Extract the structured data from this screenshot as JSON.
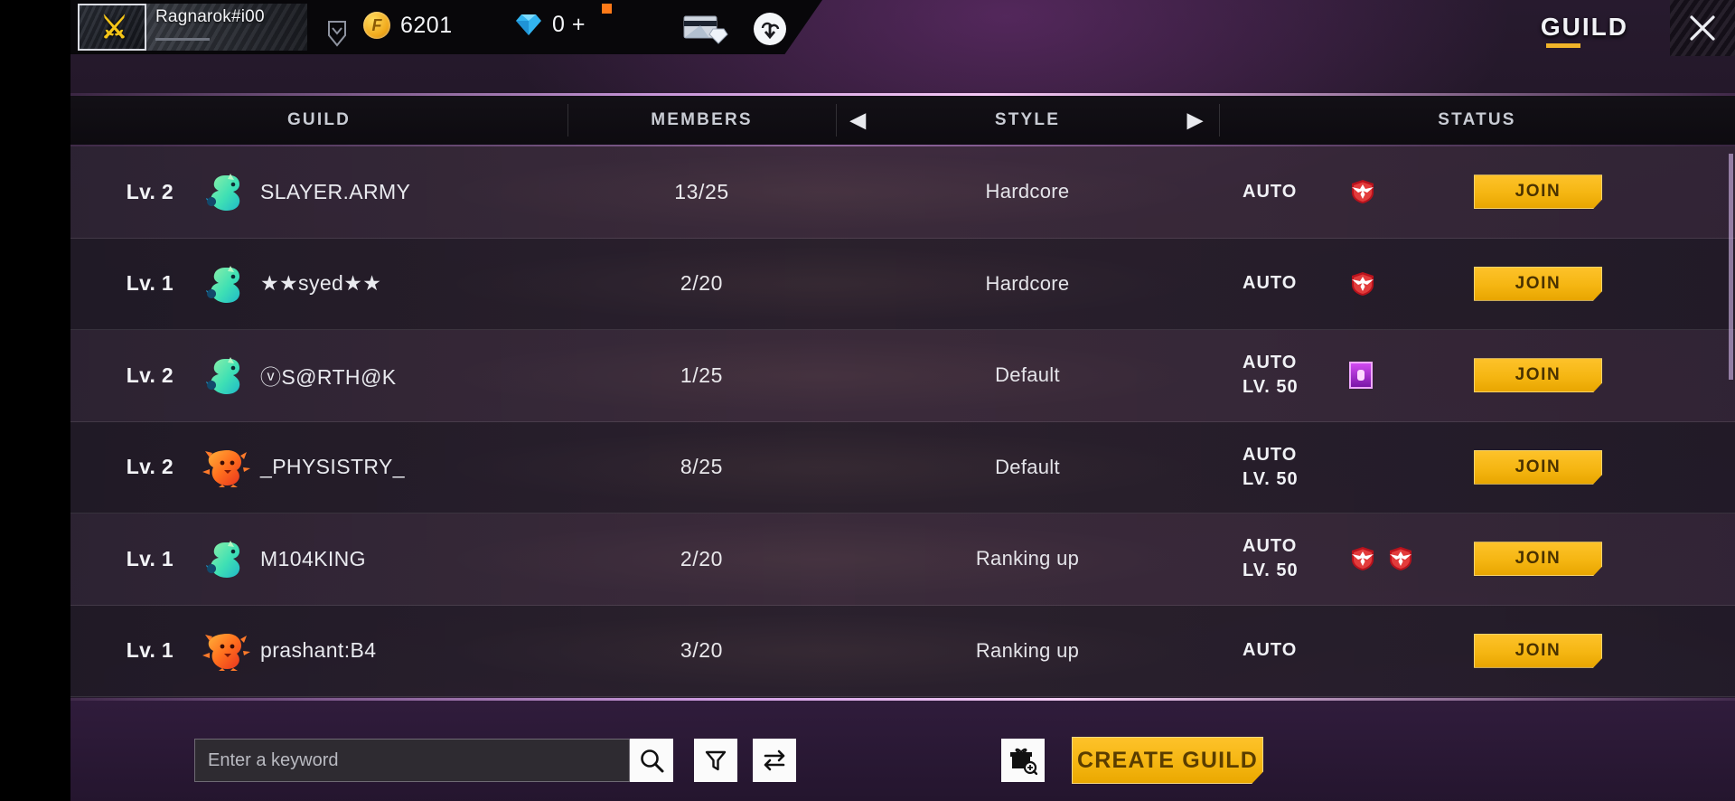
{
  "topbar": {
    "player_name": "Ragnarok#i00",
    "avatar_icon": "sword-emblem-icon",
    "rank_icon": "rank-chevron-icon",
    "gold": {
      "icon": "gold-coin-icon",
      "value": "6201"
    },
    "diamond": {
      "icon": "diamond-icon",
      "value": "0 +",
      "badge": "notification-dot"
    },
    "store_icon": "card-diamond-store-icon",
    "download_icon": "cloud-download-icon"
  },
  "header": {
    "title": "GUILD",
    "close_label": "close-icon"
  },
  "table": {
    "columns": [
      {
        "key": "guild",
        "label": "GUILD"
      },
      {
        "key": "members",
        "label": "MEMBERS"
      },
      {
        "key": "style",
        "label": "STYLE",
        "arrow_left": "◀",
        "arrow_right": "▶"
      },
      {
        "key": "status",
        "label": "STATUS"
      }
    ],
    "join_label": "JOIN",
    "rows": [
      {
        "level": "Lv. 2",
        "emblem": "dragon-emblem-green",
        "name": "SLAYER.ARMY",
        "members": "13/25",
        "style": "Hardcore",
        "status_line1": "AUTO",
        "status_line2": "",
        "badges": [
          "heroic-rank-badge"
        ]
      },
      {
        "level": "Lv. 1",
        "emblem": "dragon-emblem-green",
        "name": "★★syed★★",
        "members": "2/20",
        "style": "Hardcore",
        "status_line1": "AUTO",
        "status_line2": "",
        "badges": [
          "heroic-rank-badge"
        ]
      },
      {
        "level": "Lv. 2",
        "emblem": "dragon-emblem-green",
        "name": "ⓥS@RTH@K",
        "members": "1/25",
        "style": "Default",
        "status_line1": "AUTO",
        "status_line2": "LV. 50",
        "badges": [
          "purple-item-badge"
        ]
      },
      {
        "level": "Lv. 2",
        "emblem": "lion-emblem-orange",
        "name": "_PHYSISTRY_",
        "members": "8/25",
        "style": "Default",
        "status_line1": "AUTO",
        "status_line2": "LV. 50",
        "badges": []
      },
      {
        "level": "Lv. 1",
        "emblem": "dragon-emblem-green",
        "name": "M104KING",
        "members": "2/20",
        "style": "Ranking up",
        "status_line1": "AUTO",
        "status_line2": "LV. 50",
        "badges": [
          "heroic-rank-badge",
          "heroic-rank-badge"
        ]
      },
      {
        "level": "Lv. 1",
        "emblem": "lion-emblem-orange",
        "name": "prashant:B4",
        "members": "3/20",
        "style": "Ranking up",
        "status_line1": "AUTO",
        "status_line2": "",
        "badges": []
      }
    ]
  },
  "bottombar": {
    "search_placeholder": "Enter a keyword",
    "search_value": "",
    "search_icon": "search-icon",
    "filter_icon": "filter-icon",
    "sort_icon": "sort-swap-icon",
    "gift_icon": "gift-search-icon",
    "create_label": "CREATE GUILD"
  },
  "colors": {
    "accent_gold": "#f5b612",
    "panel_purple": "#2a1b33",
    "heroic_red": "#d3232c",
    "emblem_green": "#4fe3a8",
    "emblem_orange": "#ff6a1f"
  }
}
